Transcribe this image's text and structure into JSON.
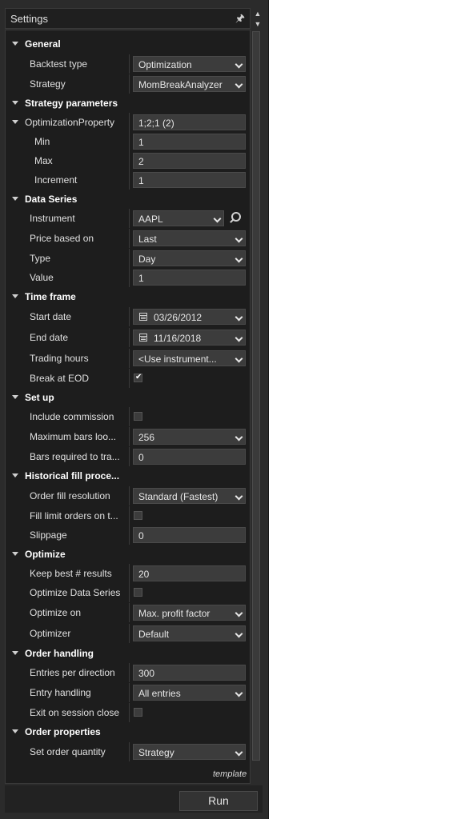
{
  "window": {
    "title": "Settings"
  },
  "general": {
    "header": "General",
    "backtest_type": {
      "label": "Backtest type",
      "value": "Optimization"
    },
    "strategy": {
      "label": "Strategy",
      "value": "MomBreakAnalyzer"
    }
  },
  "strategy_parameters": {
    "header": "Strategy parameters",
    "optimization_property": {
      "label": "OptimizationProperty",
      "value": "1;2;1 (2)"
    },
    "min": {
      "label": "Min",
      "value": "1"
    },
    "max": {
      "label": "Max",
      "value": "2"
    },
    "increment": {
      "label": "Increment",
      "value": "1"
    }
  },
  "data_series": {
    "header": "Data Series",
    "instrument": {
      "label": "Instrument",
      "value": "AAPL"
    },
    "price_based_on": {
      "label": "Price based on",
      "value": "Last"
    },
    "type": {
      "label": "Type",
      "value": "Day"
    },
    "value": {
      "label": "Value",
      "value": "1"
    }
  },
  "time_frame": {
    "header": "Time frame",
    "start_date": {
      "label": "Start date",
      "value": "03/26/2012"
    },
    "end_date": {
      "label": "End date",
      "value": "11/16/2018"
    },
    "trading_hours": {
      "label": "Trading hours",
      "value": "<Use instrument..."
    },
    "break_at_eod": {
      "label": "Break at EOD",
      "checked": true
    }
  },
  "set_up": {
    "header": "Set up",
    "include_commission": {
      "label": "Include commission",
      "checked": false
    },
    "maximum_bars": {
      "label": "Maximum bars loo...",
      "value": "256"
    },
    "bars_required": {
      "label": "Bars required to tra...",
      "value": "0"
    }
  },
  "historical_fill": {
    "header": "Historical fill proce...",
    "order_fill_resolution": {
      "label": "Order fill resolution",
      "value": "Standard (Fastest)"
    },
    "fill_limit_orders": {
      "label": "Fill limit orders on t...",
      "checked": false
    },
    "slippage": {
      "label": "Slippage",
      "value": "0"
    }
  },
  "optimize": {
    "header": "Optimize",
    "keep_best": {
      "label": "Keep best # results",
      "value": "20"
    },
    "optimize_data_series": {
      "label": "Optimize Data Series",
      "checked": false
    },
    "optimize_on": {
      "label": "Optimize on",
      "value": "Max. profit factor"
    },
    "optimizer": {
      "label": "Optimizer",
      "value": "Default"
    }
  },
  "order_handling": {
    "header": "Order handling",
    "entries_per_direction": {
      "label": "Entries per direction",
      "value": "300"
    },
    "entry_handling": {
      "label": "Entry handling",
      "value": "All entries"
    },
    "exit_on_session_close": {
      "label": "Exit on session close",
      "checked": false
    }
  },
  "order_properties": {
    "header": "Order properties",
    "set_order_quantity": {
      "label": "Set order quantity",
      "value": "Strategy"
    }
  },
  "template_link": "template",
  "run_button": "Run",
  "icons": {
    "pin": "pin-icon",
    "search": "search-icon",
    "calendar": "calendar-icon",
    "dropdown": "chevron-down-icon",
    "expand": "triangle-down-icon"
  },
  "colors": {
    "panel_bg": "#2b2b2b",
    "grid_bg": "#1d1d1d",
    "field_bg": "#3c3c3c",
    "text": "#e6e6e6"
  }
}
